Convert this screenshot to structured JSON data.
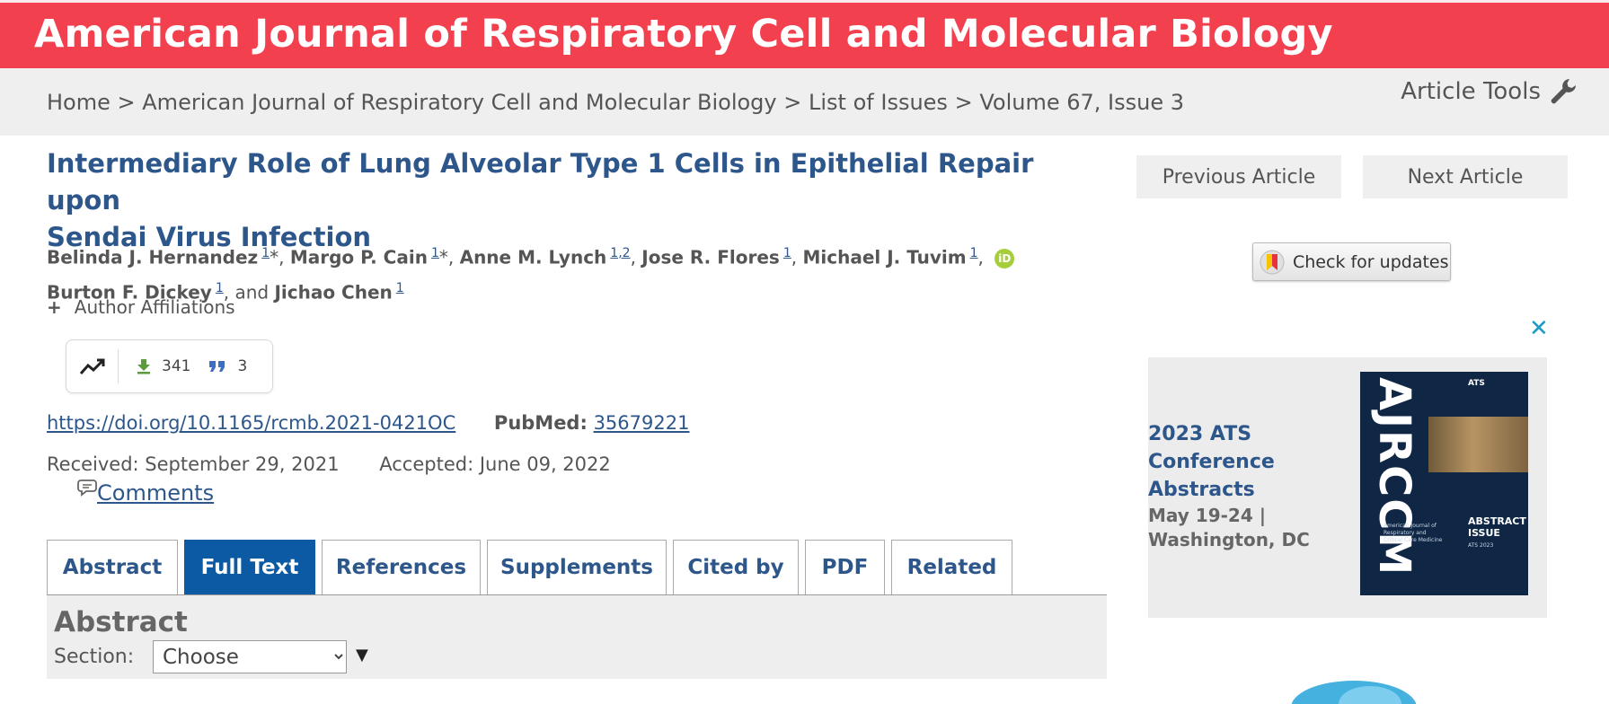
{
  "header": {
    "journal_title": "American Journal of Respiratory Cell and Molecular Biology"
  },
  "breadcrumb": {
    "items": [
      "Home",
      "American Journal of Respiratory Cell and Molecular Biology",
      "List of Issues",
      "Volume 67, Issue 3"
    ],
    "separator": ">"
  },
  "article_tools": {
    "label": "Article Tools",
    "icon": "wrench-icon"
  },
  "article": {
    "title_line1": "Intermediary Role of Lung Alveolar Type 1 Cells in Epithelial Repair upon",
    "title_line2": "Sendai Virus Infection"
  },
  "authors": [
    {
      "name": "Belinda J. Hernandez",
      "affil": "1",
      "suffix": "*"
    },
    {
      "name": "Margo P. Cain",
      "affil": "1",
      "suffix": "*"
    },
    {
      "name": "Anne M. Lynch",
      "affil": "1,2",
      "suffix": ""
    },
    {
      "name": "Jose R. Flores",
      "affil": "1",
      "suffix": ""
    },
    {
      "name": "Michael J. Tuvim",
      "affil": "1",
      "suffix": ""
    },
    {
      "name": "Burton F. Dickey",
      "affil": "1",
      "suffix": ""
    },
    {
      "name": "Jichao Chen",
      "affil": "1",
      "suffix": ""
    }
  ],
  "authors_and": "and",
  "orcid_badge": "iD",
  "affiliations": {
    "toggle": "+",
    "label": "Author Affiliations"
  },
  "metrics": {
    "trend_icon": "trending-up-icon",
    "downloads": "341",
    "citations": "3"
  },
  "doi": {
    "link": "https://doi.org/10.1165/rcmb.2021-0421OC",
    "pubmed_label": "PubMed:",
    "pubmed_id": "35679221"
  },
  "dates": {
    "received": "Received: September 29, 2021",
    "accepted": "Accepted: June 09, 2022"
  },
  "comments": {
    "label": "Comments"
  },
  "tabs": [
    {
      "label": "Abstract",
      "active": false
    },
    {
      "label": "Full Text",
      "active": true
    },
    {
      "label": "References",
      "active": false
    },
    {
      "label": "Supplements",
      "active": false
    },
    {
      "label": "Cited by",
      "active": false
    },
    {
      "label": "PDF",
      "active": false
    },
    {
      "label": "Related",
      "active": false
    }
  ],
  "abstract_panel": {
    "title": "Abstract",
    "section_label": "Section:",
    "section_value": "Choose",
    "arrow": "▼"
  },
  "sidebar": {
    "previous": "Previous Article",
    "next": "Next Article",
    "check_updates": "Check for updates",
    "ad_close": "✕"
  },
  "ad": {
    "headline": "2023 ATS Conference Abstracts",
    "dates": "May 19-24 |",
    "location": "Washington, DC",
    "cover_brand": "AJRCCM",
    "cover_publisher": "ATS",
    "cover_journal": "American Journal of Respiratory and Critical Care Medicine",
    "cover_issue": "ABSTRACT ISSUE",
    "cover_subtitle": "ATS 2023"
  },
  "colors": {
    "banner": "#f2404f",
    "title_blue": "#2d568b",
    "active_tab": "#0b5aa3",
    "orcid_green": "#a6ce39",
    "close_blue": "#1a9bc7"
  }
}
